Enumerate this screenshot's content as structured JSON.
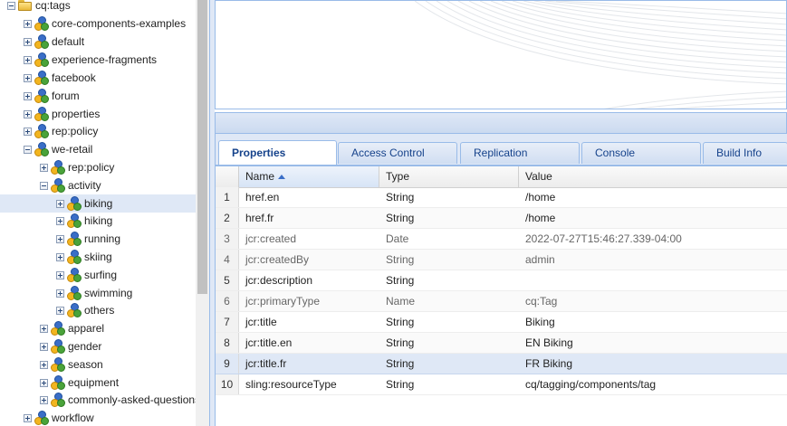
{
  "tree": {
    "root": {
      "label": "cq:tags"
    },
    "nodes": [
      {
        "label": "core-components-examples"
      },
      {
        "label": "default"
      },
      {
        "label": "experience-fragments"
      },
      {
        "label": "facebook"
      },
      {
        "label": "forum"
      },
      {
        "label": "properties"
      },
      {
        "label": "rep:policy"
      },
      {
        "label": "we-retail"
      },
      {
        "label": "rep:policy"
      },
      {
        "label": "activity"
      },
      {
        "label": "biking"
      },
      {
        "label": "hiking"
      },
      {
        "label": "running"
      },
      {
        "label": "skiing"
      },
      {
        "label": "surfing"
      },
      {
        "label": "swimming"
      },
      {
        "label": "others"
      },
      {
        "label": "apparel"
      },
      {
        "label": "gender"
      },
      {
        "label": "season"
      },
      {
        "label": "equipment"
      },
      {
        "label": "commonly-asked-questions"
      },
      {
        "label": "workflow"
      }
    ]
  },
  "tabs": [
    {
      "label": "Properties"
    },
    {
      "label": "Access Control"
    },
    {
      "label": "Replication"
    },
    {
      "label": "Console"
    },
    {
      "label": "Build Info"
    }
  ],
  "grid": {
    "columns": {
      "name": "Name",
      "type": "Type",
      "value": "Value"
    },
    "rows": [
      {
        "num": "1",
        "name": "href.en",
        "type": "String",
        "value": "/home"
      },
      {
        "num": "2",
        "name": "href.fr",
        "type": "String",
        "value": "/home"
      },
      {
        "num": "3",
        "name": "jcr:created",
        "type": "Date",
        "value": "2022-07-27T15:46:27.339-04:00"
      },
      {
        "num": "4",
        "name": "jcr:createdBy",
        "type": "String",
        "value": "admin"
      },
      {
        "num": "5",
        "name": "jcr:description",
        "type": "String",
        "value": ""
      },
      {
        "num": "6",
        "name": "jcr:primaryType",
        "type": "Name",
        "value": "cq:Tag"
      },
      {
        "num": "7",
        "name": "jcr:title",
        "type": "String",
        "value": "Biking"
      },
      {
        "num": "8",
        "name": "jcr:title.en",
        "type": "String",
        "value": "EN Biking"
      },
      {
        "num": "9",
        "name": "jcr:title.fr",
        "type": "String",
        "value": "FR Biking"
      },
      {
        "num": "10",
        "name": "sling:resourceType",
        "type": "String",
        "value": "cq/tagging/components/tag"
      }
    ]
  },
  "colors": {
    "accent": "#15428b",
    "selection": "#dfe8f6",
    "border": "#99bbe8"
  }
}
